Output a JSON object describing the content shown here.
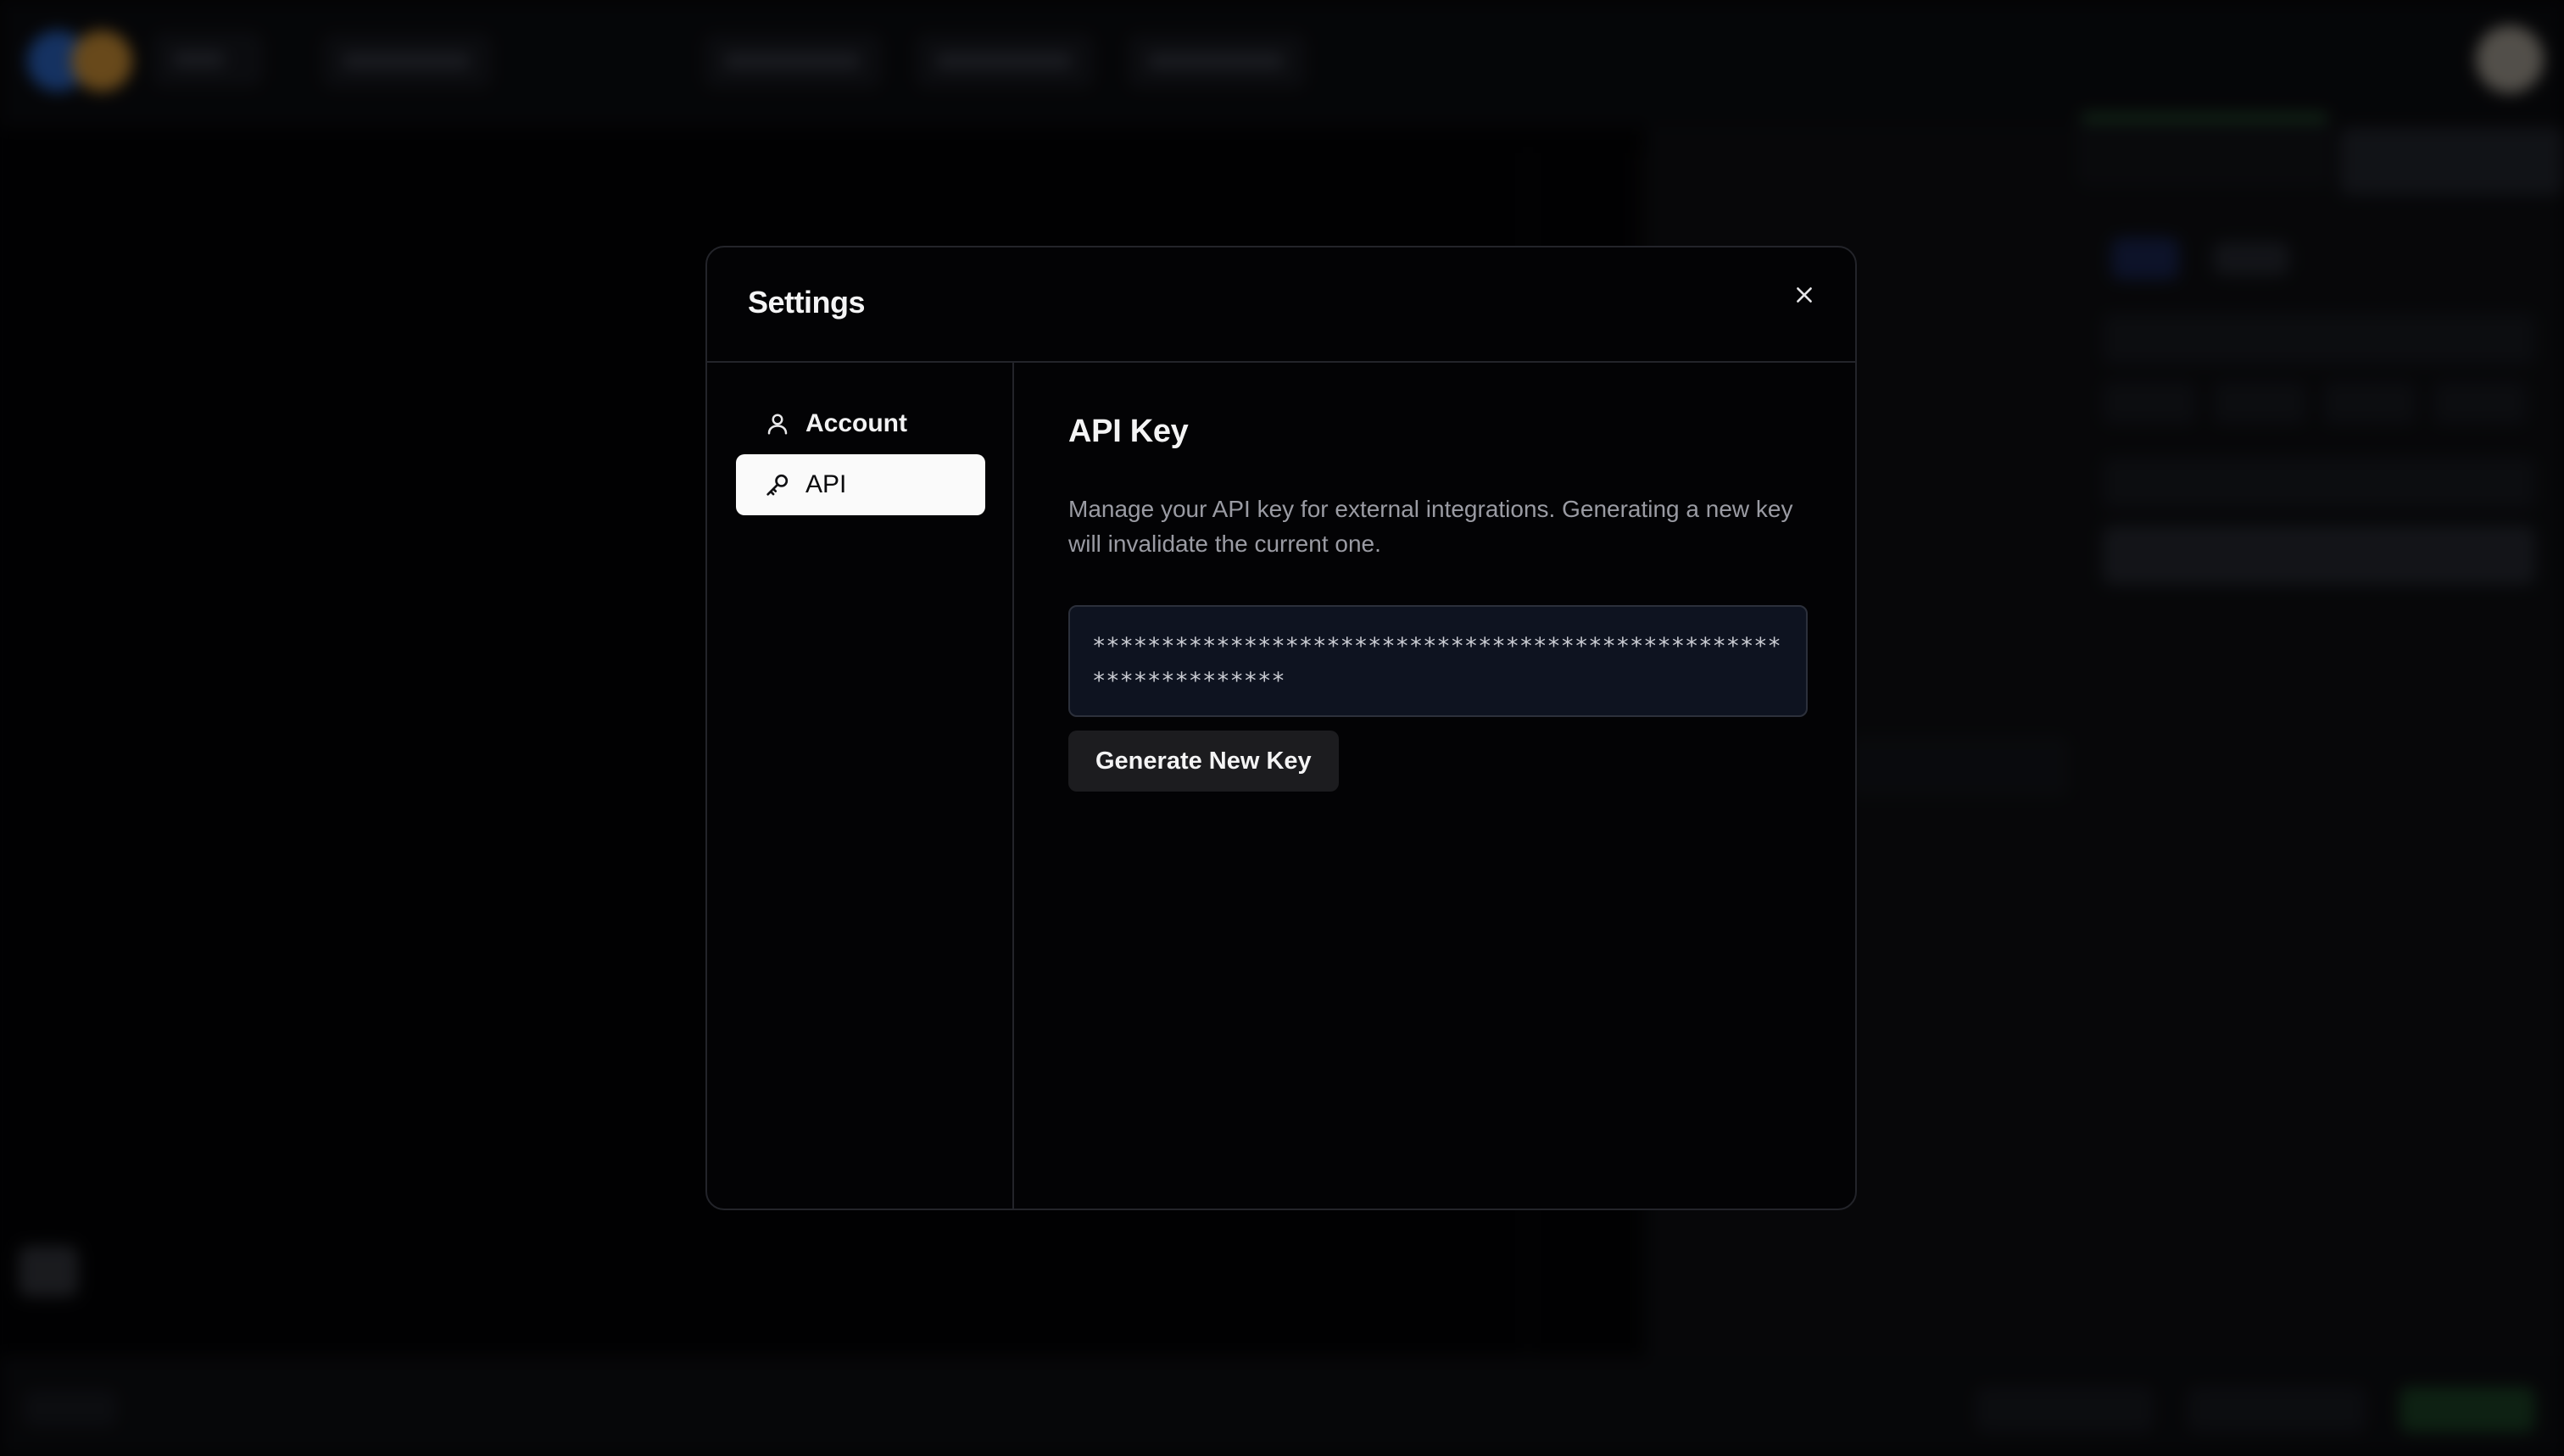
{
  "dialog": {
    "title": "Settings",
    "close_icon": "close-icon"
  },
  "sidebar": {
    "items": [
      {
        "label": "Account",
        "icon": "user-icon",
        "active": false
      },
      {
        "label": "API",
        "icon": "key-icon",
        "active": true
      }
    ]
  },
  "api": {
    "title": "API Key",
    "description": "Manage your API key for external integrations. Generating a new key will invalidate the current one.",
    "key_value": "****************************************************************",
    "generate_label": "Generate New Key"
  },
  "colors": {
    "dialog_bg": "#030305",
    "active_nav_bg": "#fafafa",
    "key_field_bg": "#0e1320",
    "button_bg": "#1c1c1f"
  }
}
